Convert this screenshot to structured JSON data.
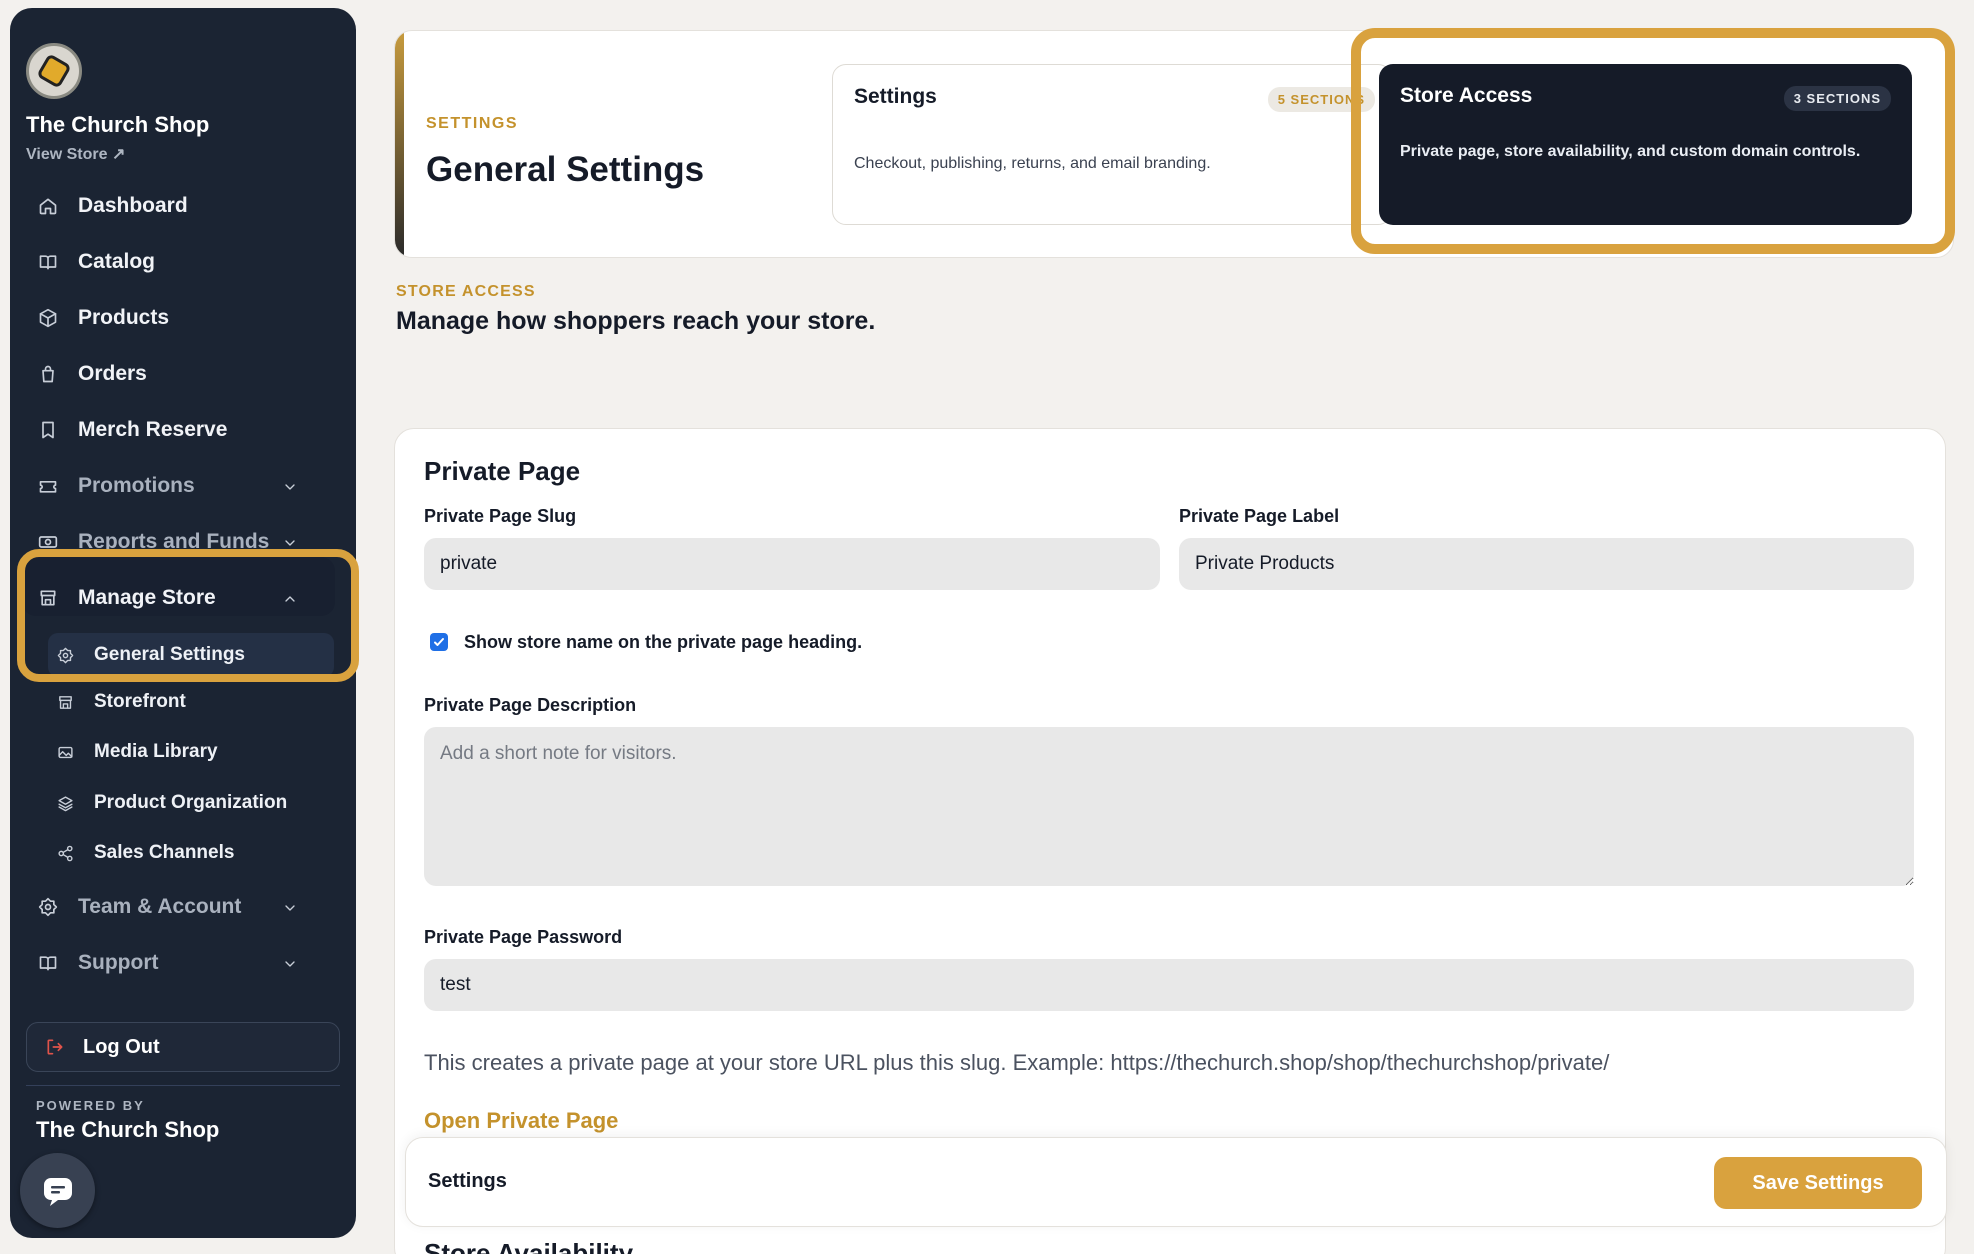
{
  "sidebar": {
    "brand": "The Church Shop",
    "view_store": "View Store ↗",
    "items": [
      {
        "label": "Dashboard",
        "icon": "home-icon"
      },
      {
        "label": "Catalog",
        "icon": "book-icon"
      },
      {
        "label": "Products",
        "icon": "box-icon"
      },
      {
        "label": "Orders",
        "icon": "bag-icon"
      },
      {
        "label": "Merch Reserve",
        "icon": "bookmark-icon"
      },
      {
        "label": "Promotions",
        "icon": "ticket-icon"
      },
      {
        "label": "Reports and Funds",
        "icon": "money-icon"
      },
      {
        "label": "Manage Store",
        "icon": "store-icon"
      }
    ],
    "sub_items": [
      {
        "label": "General Settings",
        "icon": "gear-icon"
      },
      {
        "label": "Storefront",
        "icon": "storefront-icon"
      },
      {
        "label": "Media Library",
        "icon": "image-icon"
      },
      {
        "label": "Product Organization",
        "icon": "layers-icon"
      },
      {
        "label": "Sales Channels",
        "icon": "share-icon"
      }
    ],
    "bottom_items": [
      {
        "label": "Team & Account",
        "icon": "gear-icon"
      },
      {
        "label": "Support",
        "icon": "book-icon"
      }
    ],
    "logout": "Log Out",
    "powered_by": "POWERED BY",
    "powered_name": "The Church Shop"
  },
  "header": {
    "eyebrow": "SETTINGS",
    "title": "General Settings",
    "tabs": [
      {
        "title": "Settings",
        "badge": "5 SECTIONS",
        "desc": "Checkout, publishing, returns, and email branding."
      },
      {
        "title": "Store Access",
        "badge": "3 SECTIONS",
        "desc": "Private page, store availability, and custom domain controls."
      }
    ]
  },
  "section": {
    "eyebrow": "STORE ACCESS",
    "title": "Manage how shoppers reach your store."
  },
  "private_page": {
    "title": "Private Page",
    "slug_label": "Private Page Slug",
    "slug_value": "private",
    "label_label": "Private Page Label",
    "label_value": "Private Products",
    "checkbox_label": "Show store name on the private page heading.",
    "desc_label": "Private Page Description",
    "desc_placeholder": "Add a short note for visitors.",
    "password_label": "Private Page Password",
    "password_value": "test",
    "help": "This creates a private page at your store URL plus this slug. Example: https://thechurch.shop/shop/thechurchshop/private/",
    "open_link": "Open Private Page"
  },
  "next_section_peek": "Store Availability",
  "footer": {
    "title": "Settings",
    "save": "Save Settings"
  },
  "colors": {
    "accent": "#d9a23e",
    "sidebar_bg": "#1b2433",
    "dark_card": "#151b28"
  }
}
